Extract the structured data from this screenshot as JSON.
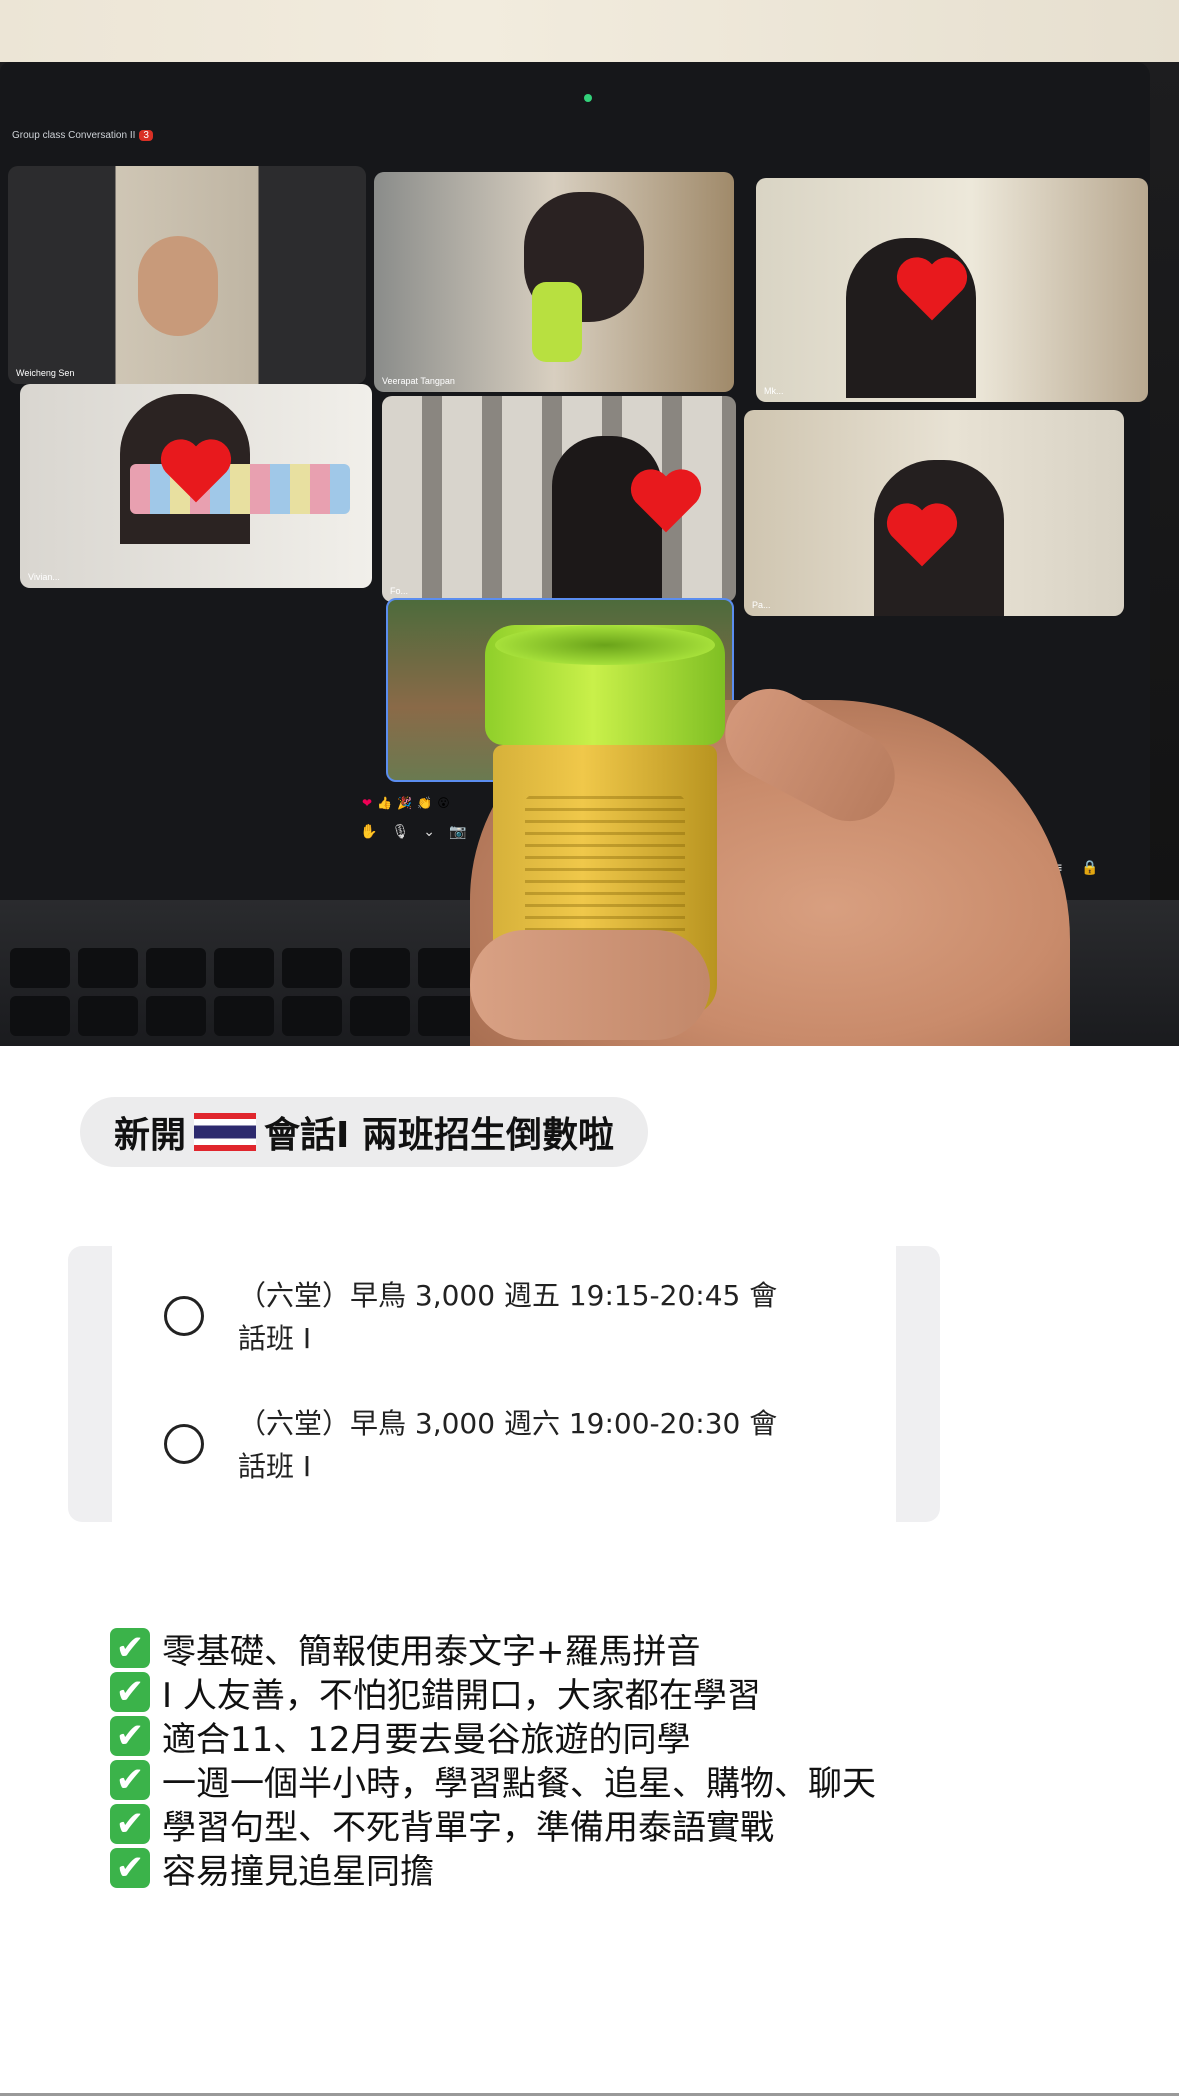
{
  "photo": {
    "meeting_title": "Group class Conversation II",
    "meeting_badge": "3",
    "tiles": [
      {
        "name": "Weicheng Sen"
      },
      {
        "name": "Veerapat Tangpan"
      },
      {
        "name": "Mk..."
      },
      {
        "name": "Vivian..."
      },
      {
        "name": "Fo..."
      },
      {
        "name": "Pa..."
      },
      {
        "name": ""
      }
    ],
    "controls": [
      "❤",
      "👍",
      "🎉",
      "👏",
      "😮"
    ],
    "mic_controls": [
      "✋",
      "🎙",
      "⌄",
      "📷"
    ],
    "right_controls": [
      "▤",
      "≡",
      "🔒"
    ]
  },
  "headline": {
    "prefix": "新開",
    "suffix": "會話I 兩班招生倒數啦",
    "flag_icon": "thailand-flag-icon"
  },
  "options": [
    {
      "line1": "（六堂）早鳥  3,000 週五 19:15-20:45 會",
      "line2": "話班 I"
    },
    {
      "line1": "（六堂）早鳥  3,000 週六 19:00-20:30 會",
      "line2": "話班 I"
    }
  ],
  "features": [
    "零基礎、簡報使用泰文字+羅馬拼音",
    "I 人友善，不怕犯錯開口，大家都在學習",
    "適合11、12月要去曼谷旅遊的同學",
    "一週一個半小時，學習點餐、追星、購物、聊天",
    "學習句型、不死背單字，準備用泰語實戰",
    "容易撞見追星同擔"
  ],
  "check_icon": "✔",
  "colors": {
    "check_green": "#3bb34a",
    "pill_bg": "#ececed"
  }
}
